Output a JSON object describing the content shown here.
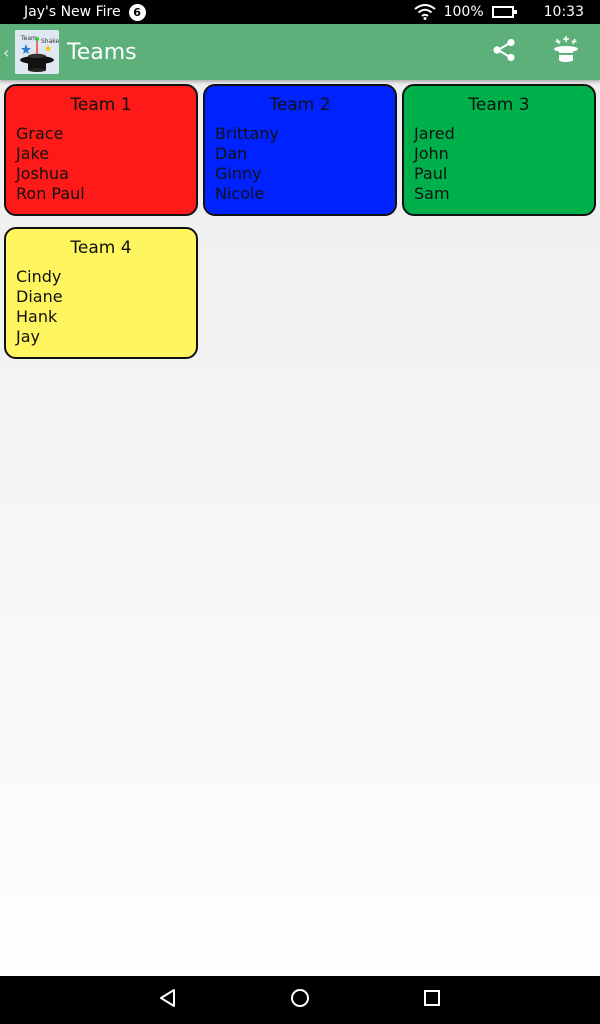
{
  "status_bar": {
    "device_name": "Jay's New Fire",
    "notification_count": "6",
    "battery": "100%",
    "time": "10:33",
    "icons": [
      "wifi-icon",
      "battery-icon"
    ]
  },
  "app_bar": {
    "title": "Teams",
    "color": "#5db07a",
    "logo": "top-hat-magic-logo",
    "actions": [
      "share-icon",
      "magic-hat-shuffle-icon"
    ]
  },
  "teams": [
    {
      "name": "Team 1",
      "color": "#ff1a1a",
      "members": [
        "Grace",
        "Jake",
        "Joshua",
        "Ron Paul"
      ]
    },
    {
      "name": "Team 2",
      "color": "#0022ff",
      "members": [
        "Brittany",
        "Dan",
        "Ginny",
        "Nicole"
      ]
    },
    {
      "name": "Team 3",
      "color": "#00b04a",
      "members": [
        "Jared",
        "John",
        "Paul",
        "Sam"
      ]
    },
    {
      "name": "Team 4",
      "color": "#fff55e",
      "members": [
        "Cindy",
        "Diane",
        "Hank",
        "Jay"
      ]
    }
  ],
  "nav_bar": {
    "buttons": [
      "back-icon",
      "home-icon",
      "recents-icon"
    ]
  }
}
